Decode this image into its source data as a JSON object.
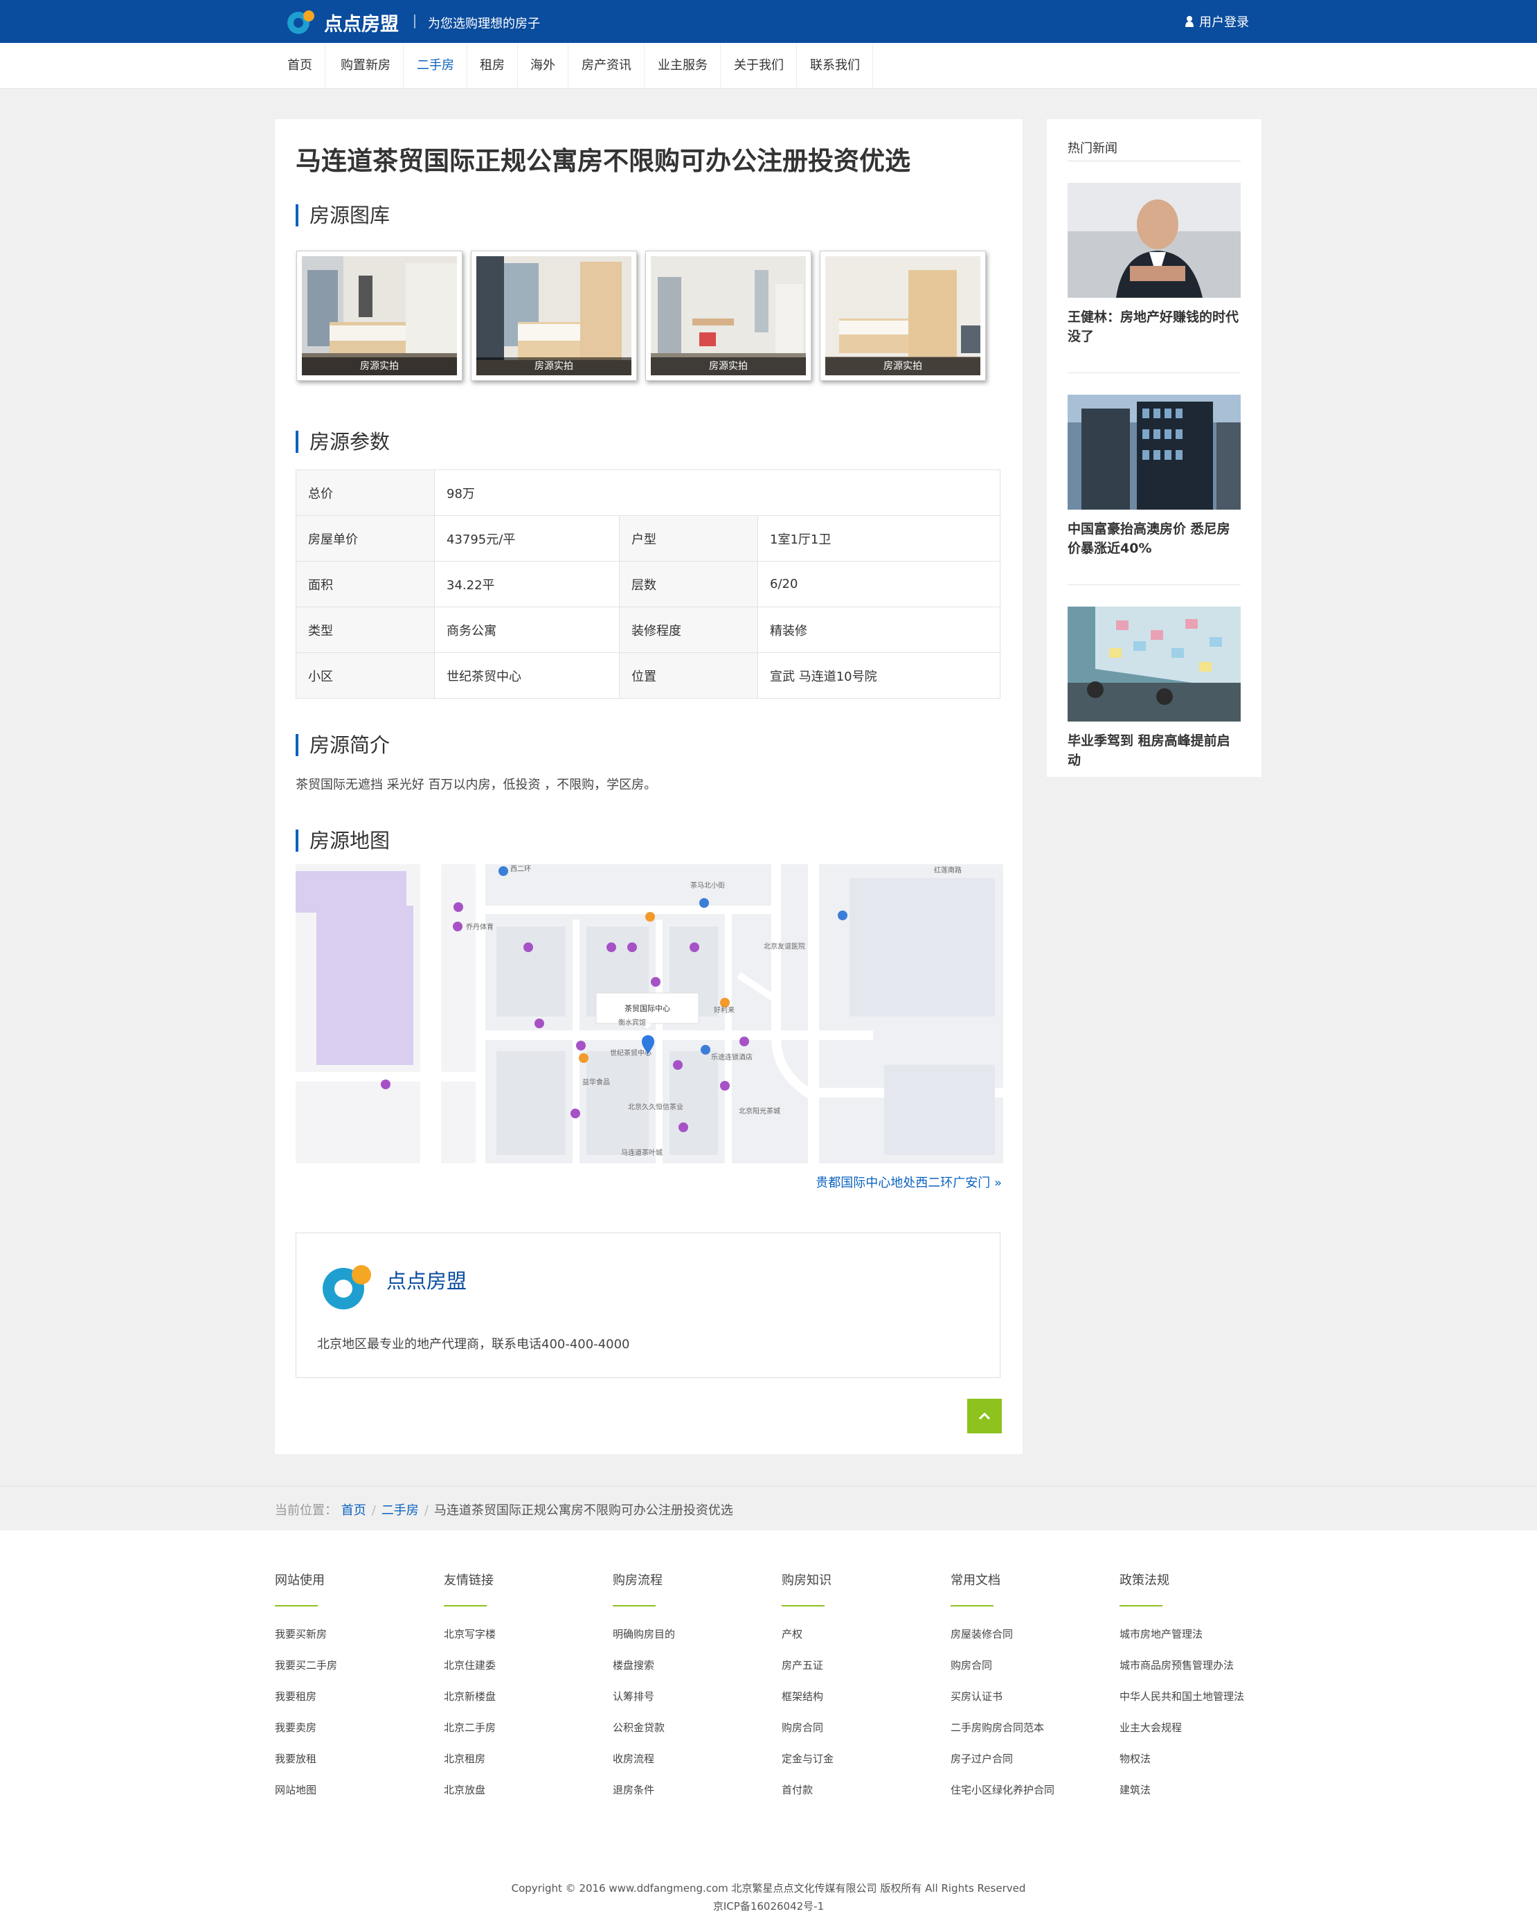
{
  "header": {
    "brand": "点点房盟",
    "slogan": "为您选购理想的房子",
    "login": "用户登录"
  },
  "nav": [
    "首页",
    "购置新房",
    "二手房",
    "租房",
    "海外",
    "房产资讯",
    "业主服务",
    "关于我们",
    "联系我们"
  ],
  "nav_active": "二手房",
  "listing": {
    "title": "马连道茶贸国际正规公寓房不限购可办公注册投资优选",
    "gallery_heading": "房源图库",
    "photo_caption": "房源实拍",
    "params_heading": "房源参数",
    "params": {
      "total_label": "总价",
      "total_value": "98万",
      "unit_label": "房屋单价",
      "unit_value": "43795元/平",
      "layout_label": "户型",
      "layout_value": "1室1厅1卫",
      "area_label": "面积",
      "area_value": "34.22平",
      "floor_label": "层数",
      "floor_value": "6/20",
      "type_label": "类型",
      "type_value": "商务公寓",
      "decor_label": "装修程度",
      "decor_value": "精装修",
      "community_label": "小区",
      "community_value": "世纪茶贸中心",
      "location_label": "位置",
      "location_value": "宣武 马连道10号院"
    },
    "intro_heading": "房源简介",
    "intro_text": "茶贸国际无遮挡 采光好 百万以内房，低投资 ，不限购，学区房。",
    "map_heading": "房源地图",
    "map_marker": "茶贸国际中心",
    "map_labels": [
      "茶马北小街",
      "红莲南路",
      "北京友谊医院",
      "乔丹体育",
      "西二环",
      "世纪茶贸中心",
      "益华食品",
      "乐途连锁酒店",
      "北京久久恒信茶业",
      "衡水宾馆",
      "好利来",
      "北京阳光茶城",
      "马连道茶叶城"
    ],
    "map_link": "贵都国际中心地处西二环广安门 »",
    "brand_name": "点点房盟",
    "brand_desc": "北京地区最专业的地产代理商，联系电话400-400-4000"
  },
  "sidebar": {
    "heading": "热门新闻",
    "news": [
      "王健林：房地产好赚钱的时代没了",
      "中国富豪抬高澳房价 悉尼房价暴涨近40%",
      "毕业季驾到 租房高峰提前启动"
    ]
  },
  "breadcrumb": {
    "label": "当前位置：",
    "home": "首页",
    "section": "二手房",
    "current": "马连道茶贸国际正规公寓房不限购可办公注册投资优选"
  },
  "footer": {
    "columns": [
      {
        "title": "网站使用",
        "links": [
          "我要买新房",
          "我要买二手房",
          "我要租房",
          "我要卖房",
          "我要放租",
          "网站地图"
        ]
      },
      {
        "title": "友情链接",
        "links": [
          "北京写字楼",
          "北京住建委",
          "北京新楼盘",
          "北京二手房",
          "北京租房",
          "北京放盘"
        ]
      },
      {
        "title": "购房流程",
        "links": [
          "明确购房目的",
          "楼盘搜索",
          "认筹排号",
          "公积金贷款",
          "收房流程",
          "退房条件"
        ]
      },
      {
        "title": "购房知识",
        "links": [
          "产权",
          "房产五证",
          "框架结构",
          "购房合同",
          "定金与订金",
          "首付款"
        ]
      },
      {
        "title": "常用文档",
        "links": [
          "房屋装修合同",
          "购房合同",
          "买房认证书",
          "二手房购房合同范本",
          "房子过户合同",
          "住宅小区绿化养护合同"
        ]
      },
      {
        "title": "政策法规",
        "links": [
          "城市房地产管理法",
          "城市商品房预售管理办法",
          "中华人民共和国土地管理法",
          "业主大会规程",
          "物权法",
          "建筑法"
        ]
      }
    ],
    "copyright": "Copyright © 2016 www.ddfangmeng.com 北京繁星点点文化传媒有限公司 版权所有 All Rights Reserved",
    "icp": "京ICP备16026042号-1"
  },
  "colors": {
    "brand_blue": "#0a4c9e",
    "link_blue": "#0a62c0",
    "accent_green": "#8dc21f",
    "logo_orange": "#f5a623",
    "logo_teal": "#1e9fd0"
  }
}
